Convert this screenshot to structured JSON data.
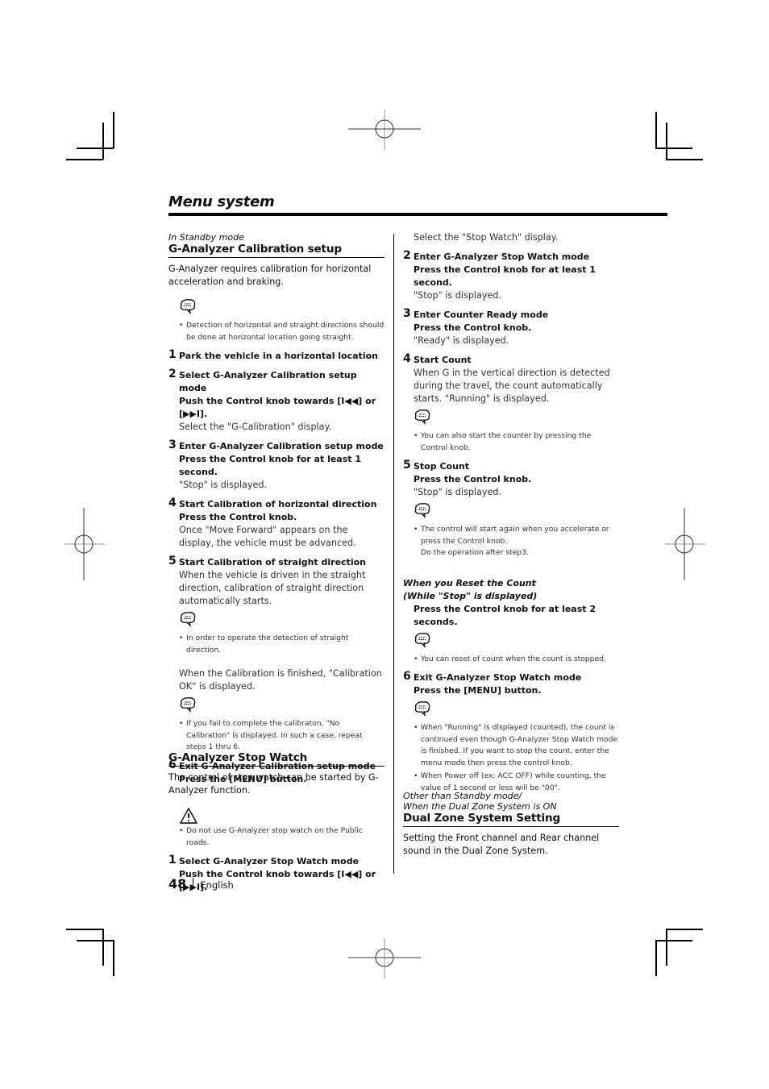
{
  "page": {
    "title": "Menu system",
    "page_number": "48",
    "language": "English"
  },
  "icons": {
    "note": "note-speech-bubble-icon",
    "warning": "warning-triangle-icon"
  },
  "left": {
    "calibration": {
      "mode": "In Standby mode",
      "heading": "G-Analyzer Calibration setup",
      "intro": "G-Analyzer requires calibration for horizontal acceleration and braking.",
      "note": "Detection of horizontal and straight directions should be done at horizontal location going straight.",
      "steps": [
        {
          "num": "1",
          "title": "Park the vehicle in a horizontal location"
        },
        {
          "num": "2",
          "title": "Select G-Analyzer Calibration setup mode",
          "action": "Push the Control knob towards [I◀◀] or [▶▶I].",
          "text": "Select the \"G-Calibration\" display."
        },
        {
          "num": "3",
          "title": "Enter G-Analyzer Calibration setup mode",
          "action": "Press the Control knob for at least 1 second.",
          "text": "\"Stop\" is displayed."
        },
        {
          "num": "4",
          "title": "Start Calibration of horizontal direction",
          "action": "Press the Control knob.",
          "text": "Once \"Move Forward\" appears on the display, the vehicle must be advanced."
        },
        {
          "num": "5",
          "title": "Start Calibration of straight direction",
          "text": "When the vehicle is driven in the straight direction, calibration of straight direction automatically starts.",
          "note": "In order to operate the detection of straight direction.",
          "text2": "When the Calibration is finished, \"Calibration OK\" is displayed.",
          "note2": "If you fail to complete the calibraton, \"No Calibration\" is displayed. In such a case, repeat steps 1 thru 6."
        },
        {
          "num": "6",
          "title": "Exit G-Analyzer Calibration setup mode",
          "action": "Press the [MENU] button."
        }
      ]
    },
    "stopwatch": {
      "heading": "G-Analyzer Stop Watch",
      "intro": "The control of stop watch can be started by G-Analyzer function.",
      "warning": "Do not use G-Analyzer stop watch on the Public roads.",
      "step1": {
        "num": "1",
        "title": "Select G-Analyzer Stop Watch mode",
        "action": "Push the Control knob towards [I◀◀] or [▶▶I]."
      }
    }
  },
  "right": {
    "stopwatch_cont": {
      "step1_text": "Select the \"Stop Watch\" display.",
      "steps": [
        {
          "num": "2",
          "title": "Enter G-Analyzer Stop Watch mode",
          "action": "Press the Control knob for at least 1 second.",
          "text": "\"Stop\" is displayed."
        },
        {
          "num": "3",
          "title": "Enter Counter Ready mode",
          "action": "Press the Control knob.",
          "text": "\"Ready\" is displayed."
        },
        {
          "num": "4",
          "title": "Start Count",
          "text": "When G in the vertical direction is detected during the travel, the count automatically starts. \"Running\" is displayed.",
          "note": "You can also start the counter by pressing the Control knob."
        },
        {
          "num": "5",
          "title": "Stop Count",
          "action": "Press the Control knob.",
          "text": "\"Stop\" is displayed.",
          "note": "The control will start again when you accelerate or press the Control knob.",
          "note_line2": "Do the operation after step3."
        }
      ],
      "reset": {
        "heading_line1": "When you Reset the Count",
        "heading_line2": "(While \"Stop\" is displayed)",
        "action": "Press the Control knob for at least 2 seconds.",
        "note": "You can reset of count when the count is stopped."
      },
      "step6": {
        "num": "6",
        "title": "Exit G-Analyzer Stop Watch mode",
        "action": "Press the [MENU] button.",
        "notes": [
          "When \"Running\" is displayed (counted), the count is continued  even though G-Analyzer Stop Watch mode is finished. If you want to stop the count, enter the menu mode then press the control knob.",
          "When Power off (ex; ACC OFF) while counting, the value of 1 second or less will be \"00\"."
        ]
      }
    },
    "dualzone": {
      "mode_line1": "Other than Standby mode/",
      "mode_line2": "When the Dual Zone System is ON",
      "heading": "Dual Zone System Setting",
      "intro": "Setting the Front channel and Rear channel sound in the Dual Zone System."
    }
  }
}
